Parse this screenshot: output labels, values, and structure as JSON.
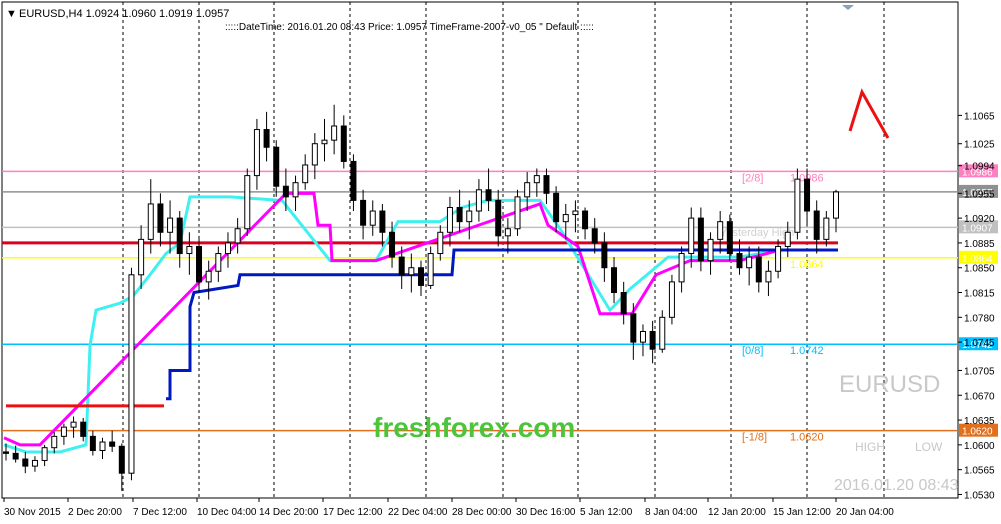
{
  "header": {
    "symbol_info": "EURUSD,H4  1.0924 1.0960 1.0919 1.0957",
    "indicator_info": ":::::DateTime: 2016.01.20 08:43   Price: 1.0957   TimeFrame-2007-v0_05   \"   Default   :::::"
  },
  "watermark": {
    "symbol": "EURUSD",
    "site": "freshforex.com",
    "high_label": "HIGH",
    "low_label": "LOW",
    "datetime": "2016.01.20 08:43"
  },
  "colors": {
    "background": "#ffffff",
    "candles": "#000000",
    "grid": "#000000",
    "murrey_high": "#ff80c0",
    "murrey_pivot": "#808080",
    "murrey_low": "#00bfff",
    "murrey_minus": "#e0701e",
    "yesterday_high": "#dc0020",
    "yesterday_low": "#ffff00",
    "trend_cyan": "#40f0f0",
    "trend_magenta": "#ff00ff",
    "trend_blue": "#0018c0",
    "trend_red": "#ee1010",
    "site_green": "#4cc43c",
    "arrow": "#ee1010"
  },
  "chart_data": {
    "type": "candlestick",
    "symbol": "EURUSD",
    "timeframe": "H4",
    "ylim": [
      1.0525,
      1.1225
    ],
    "y_ticks": [
      "1.1065",
      "1.1025",
      "1.0994",
      "1.0955",
      "1.0920",
      "1.0885",
      "1.0850",
      "1.0815",
      "1.0780",
      "1.0745",
      "1.0705",
      "1.0670",
      "1.0635",
      "1.0600",
      "1.0565",
      "1.0530"
    ],
    "x_labels": [
      "30 Nov 2015",
      "2 Dec 20:00",
      "7 Dec 12:00",
      "10 Dec 04:00",
      "14 Dec 20:00",
      "17 Dec 12:00",
      "22 Dec 04:00",
      "28 Dec 00:00",
      "30 Dec 16:00",
      "5 Jan 12:00",
      "8 Jan 04:00",
      "12 Jan 20:00",
      "15 Jan 12:00",
      "20 Jan 04:00"
    ],
    "current_price": "1.0957",
    "levels": [
      {
        "name": "[2/8]",
        "value": "1.0986",
        "price": 1.0986,
        "color": "#ff80c0",
        "label": "[2/8]",
        "label_value": "1.0986"
      },
      {
        "name": "current",
        "value": "1.0957",
        "price": 1.0957,
        "color": "#909090",
        "label": "",
        "label_value": ""
      },
      {
        "name": "pivot",
        "value": "1.0907",
        "price": 1.0907,
        "color": "#c0c0c0",
        "label": "",
        "label_value": ""
      },
      {
        "name": "yesterday",
        "value": "1.0864",
        "price": 1.0864,
        "color": "#ffff00",
        "label": "",
        "label_value": "1.0864"
      },
      {
        "name": "[0/8]",
        "value": "1.0742",
        "price": 1.0742,
        "color": "#00bfff",
        "label": "[0/8]",
        "label_value": "1.0742"
      },
      {
        "name": "[-1/8]",
        "value": "1.0620",
        "price": 1.062,
        "color": "#e0701e",
        "label": "[-1/8]",
        "label_value": "1.0620"
      }
    ],
    "red_level": 1.0885,
    "faint_label": "Yesterday High",
    "bars": [
      [
        1.059,
        1.0602,
        1.0578,
        1.0588
      ],
      [
        1.0588,
        1.0599,
        1.0575,
        1.058
      ],
      [
        1.058,
        1.059,
        1.056,
        1.057
      ],
      [
        1.057,
        1.0584,
        1.0562,
        1.0578
      ],
      [
        1.0578,
        1.06,
        1.057,
        1.0596
      ],
      [
        1.0596,
        1.0618,
        1.0588,
        1.0612
      ],
      [
        1.0612,
        1.063,
        1.06,
        1.0625
      ],
      [
        1.0625,
        1.064,
        1.061,
        1.0632
      ],
      [
        1.0632,
        1.0638,
        1.0605,
        1.0612
      ],
      [
        1.0612,
        1.062,
        1.0585,
        1.0592
      ],
      [
        1.0592,
        1.061,
        1.058,
        1.0604
      ],
      [
        1.0604,
        1.062,
        1.059,
        1.0598
      ],
      [
        1.0598,
        1.0602,
        1.0535,
        1.056
      ],
      [
        1.056,
        1.085,
        1.055,
        1.084
      ],
      [
        1.084,
        1.091,
        1.082,
        1.089
      ],
      [
        1.089,
        1.0975,
        1.087,
        1.094
      ],
      [
        1.094,
        1.0955,
        1.088,
        1.09
      ],
      [
        1.09,
        1.0945,
        1.087,
        1.092
      ],
      [
        1.092,
        1.093,
        1.085,
        1.087
      ],
      [
        1.087,
        1.09,
        1.084,
        1.088
      ],
      [
        1.088,
        1.0895,
        1.0815,
        1.083
      ],
      [
        1.083,
        1.086,
        1.0805,
        1.0845
      ],
      [
        1.0845,
        1.088,
        1.083,
        1.087
      ],
      [
        1.087,
        1.09,
        1.085,
        1.0885
      ],
      [
        1.0885,
        1.092,
        1.087,
        1.0905
      ],
      [
        1.0905,
        1.099,
        1.0895,
        1.098
      ],
      [
        1.098,
        1.106,
        1.096,
        1.1045
      ],
      [
        1.1045,
        1.107,
        1.1,
        1.102
      ],
      [
        1.102,
        1.103,
        1.095,
        1.0965
      ],
      [
        1.0965,
        1.099,
        1.093,
        1.095
      ],
      [
        1.095,
        1.098,
        1.093,
        1.097
      ],
      [
        1.097,
        1.101,
        1.096,
        1.0995
      ],
      [
        1.0995,
        1.104,
        1.0975,
        1.1025
      ],
      [
        1.1025,
        1.106,
        1.1,
        1.103
      ],
      [
        1.103,
        1.108,
        1.101,
        1.105
      ],
      [
        1.105,
        1.1065,
        1.099,
        1.1
      ],
      [
        1.1,
        1.101,
        1.093,
        1.0945
      ],
      [
        1.0945,
        1.096,
        1.089,
        1.091
      ],
      [
        1.091,
        1.0945,
        1.0895,
        1.093
      ],
      [
        1.093,
        1.094,
        1.088,
        1.09
      ],
      [
        1.09,
        1.0915,
        1.085,
        1.0865
      ],
      [
        1.0865,
        1.088,
        1.082,
        1.084
      ],
      [
        1.084,
        1.087,
        1.0815,
        1.085
      ],
      [
        1.085,
        1.086,
        1.081,
        1.0825
      ],
      [
        1.0825,
        1.088,
        1.082,
        1.087
      ],
      [
        1.087,
        1.091,
        1.086,
        1.09
      ],
      [
        1.09,
        1.095,
        1.088,
        1.0935
      ],
      [
        1.0935,
        1.096,
        1.09,
        1.0915
      ],
      [
        1.0915,
        1.0945,
        1.089,
        1.093
      ],
      [
        1.093,
        1.0975,
        1.0915,
        1.096
      ],
      [
        1.096,
        1.099,
        1.093,
        1.0945
      ],
      [
        1.0945,
        1.096,
        1.088,
        1.0895
      ],
      [
        1.0895,
        1.092,
        1.087,
        1.0905
      ],
      [
        1.0905,
        1.096,
        1.0895,
        1.095
      ],
      [
        1.095,
        1.0985,
        1.093,
        1.097
      ],
      [
        1.097,
        1.099,
        1.095,
        1.098
      ],
      [
        1.098,
        1.099,
        1.094,
        1.0955
      ],
      [
        1.0955,
        1.0965,
        1.09,
        1.0915
      ],
      [
        1.0915,
        1.094,
        1.089,
        1.0925
      ],
      [
        1.0925,
        1.0945,
        1.09,
        1.093
      ],
      [
        1.093,
        1.0935,
        1.089,
        1.0905
      ],
      [
        1.0905,
        1.092,
        1.087,
        1.0885
      ],
      [
        1.0885,
        1.09,
        1.083,
        1.085
      ],
      [
        1.085,
        1.0865,
        1.08,
        1.0815
      ],
      [
        1.0815,
        1.083,
        1.077,
        1.0785
      ],
      [
        1.0785,
        1.08,
        1.072,
        1.0745
      ],
      [
        1.0745,
        1.077,
        1.0725,
        1.076
      ],
      [
        1.076,
        1.0775,
        1.0715,
        1.0735
      ],
      [
        1.0735,
        1.079,
        1.073,
        1.078
      ],
      [
        1.078,
        1.084,
        1.077,
        1.083
      ],
      [
        1.083,
        1.088,
        1.0815,
        1.087
      ],
      [
        1.087,
        1.0935,
        1.085,
        1.092
      ],
      [
        1.092,
        1.0935,
        1.0845,
        1.086
      ],
      [
        1.086,
        1.09,
        1.084,
        1.089
      ],
      [
        1.089,
        1.093,
        1.087,
        1.0915
      ],
      [
        1.0915,
        1.0925,
        1.086,
        1.087
      ],
      [
        1.087,
        1.089,
        1.084,
        1.085
      ],
      [
        1.085,
        1.088,
        1.0825,
        1.0865
      ],
      [
        1.0865,
        1.088,
        1.0815,
        1.083
      ],
      [
        1.083,
        1.086,
        1.081,
        1.0845
      ],
      [
        1.0845,
        1.089,
        1.0835,
        1.088
      ],
      [
        1.088,
        1.0915,
        1.0865,
        1.09
      ],
      [
        1.09,
        1.099,
        1.089,
        1.0975
      ],
      [
        1.0975,
        1.099,
        1.091,
        1.093
      ],
      [
        1.093,
        1.0945,
        1.087,
        1.089
      ],
      [
        1.089,
        1.093,
        1.088,
        1.092
      ],
      [
        1.092,
        1.096,
        1.09,
        1.0957
      ]
    ]
  }
}
